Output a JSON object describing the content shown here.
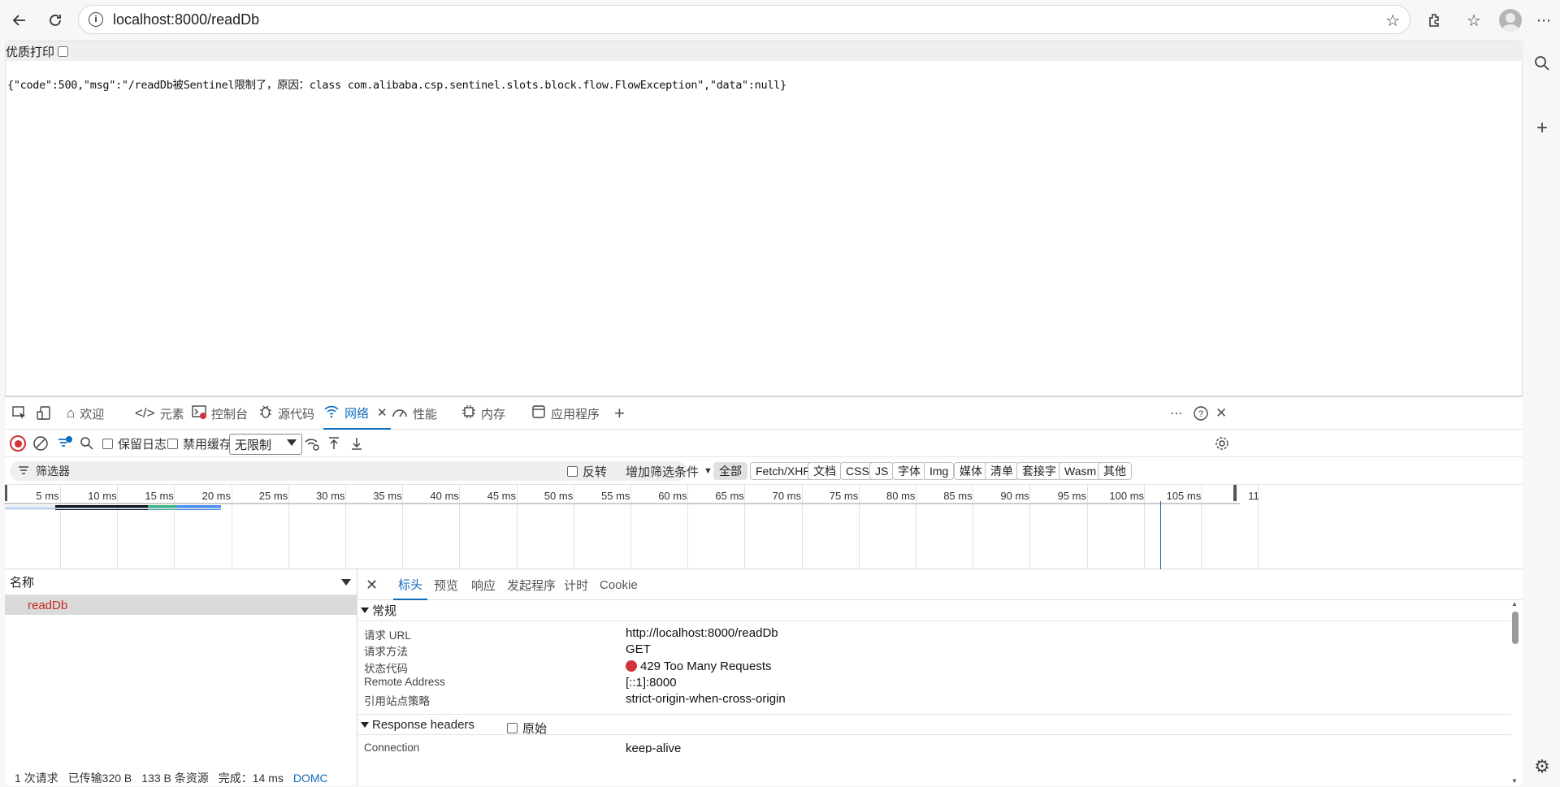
{
  "browser": {
    "url": "localhost:8000/readDb"
  },
  "page": {
    "print_label": "优质打印",
    "body_text": "{\"code\":500,\"msg\":\"/readDb被Sentinel限制了，原因：class com.alibaba.csp.sentinel.slots.block.flow.FlowException\",\"data\":null}"
  },
  "devtools": {
    "tabs": [
      {
        "label": "欢迎",
        "icon": "home-icon"
      },
      {
        "label": "元素",
        "icon": "code-icon"
      },
      {
        "label": "控制台",
        "icon": "console-icon"
      },
      {
        "label": "源代码",
        "icon": "bug-icon"
      },
      {
        "label": "网络",
        "icon": "wifi-icon"
      },
      {
        "label": "性能",
        "icon": "gauge-icon"
      },
      {
        "label": "内存",
        "icon": "chip-icon"
      },
      {
        "label": "应用程序",
        "icon": "window-icon"
      }
    ],
    "toolbar": {
      "preserve_log": "保留日志",
      "disable_cache": "禁用缓存",
      "throttle": "无限制"
    },
    "filter": {
      "placeholder": "筛选器",
      "invert": "反转",
      "more_filters": "增加筛选条件",
      "types": [
        "全部",
        "Fetch/XHR",
        "文档",
        "CSS",
        "JS",
        "字体",
        "Img",
        "媒体",
        "清单",
        "套接字",
        "Wasm",
        "其他"
      ]
    },
    "timeline": {
      "ticks": [
        "5 ms",
        "10 ms",
        "15 ms",
        "20 ms",
        "25 ms",
        "30 ms",
        "35 ms",
        "40 ms",
        "45 ms",
        "50 ms",
        "55 ms",
        "60 ms",
        "65 ms",
        "70 ms",
        "75 ms",
        "80 ms",
        "85 ms",
        "90 ms",
        "95 ms",
        "100 ms",
        "105 ms",
        "11"
      ]
    },
    "requests": {
      "header": "名称",
      "rows": [
        "readDb"
      ]
    },
    "status_bar": {
      "requests": "1 次请求",
      "transferred": "已传输320 B",
      "resources": "133 B 条资源",
      "finish": "完成：14 ms",
      "domc": "DOMC"
    },
    "detail": {
      "tabs": [
        "标头",
        "预览",
        "响应",
        "发起程序",
        "计时",
        "Cookie"
      ],
      "general_title": "常规",
      "general": [
        {
          "k": "请求 URL",
          "v": "http://localhost:8000/readDb"
        },
        {
          "k": "请求方法",
          "v": "GET"
        },
        {
          "k": "状态代码",
          "v": "429 Too Many Requests"
        },
        {
          "k": "Remote Address",
          "v": "[::1]:8000"
        },
        {
          "k": "引用站点策略",
          "v": "strict-origin-when-cross-origin"
        }
      ],
      "response_headers_title": "Response headers",
      "raw_label": "原始",
      "response_headers": [
        {
          "k": "Connection",
          "v": "keep-alive"
        }
      ]
    }
  },
  "colors": {
    "accent": "#0f6cbd",
    "error": "#d13438"
  }
}
